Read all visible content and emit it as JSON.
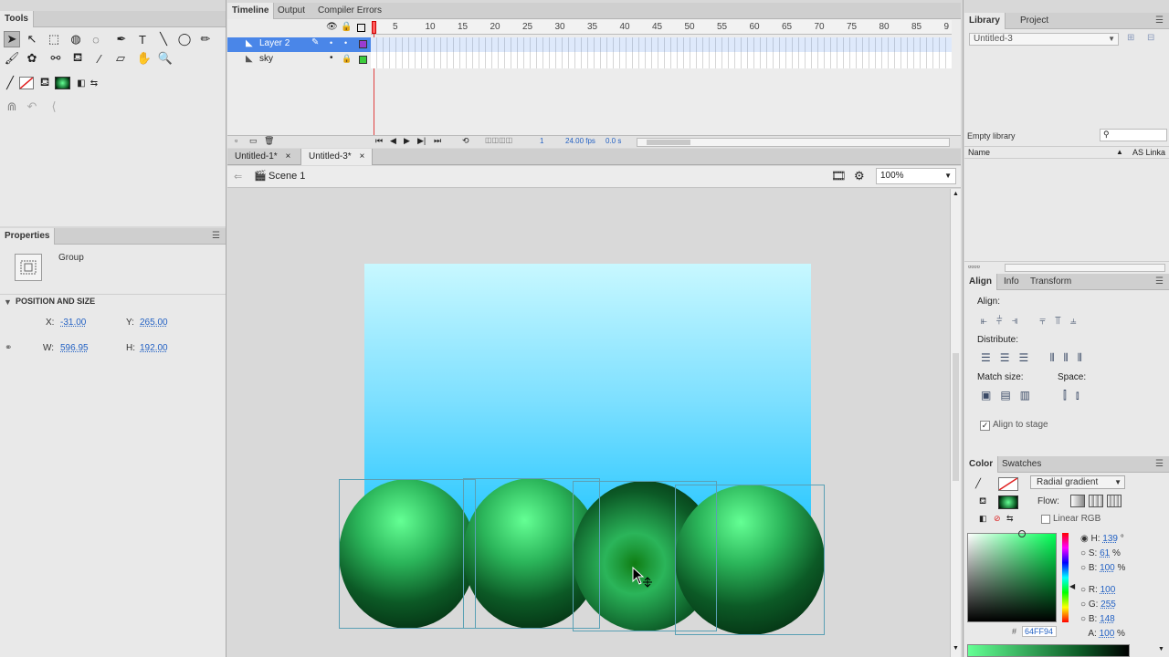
{
  "tools": {
    "tab_label": "Tools"
  },
  "timeline": {
    "tabs": [
      "Timeline",
      "Output",
      "Compiler Errors"
    ],
    "frame_numbers": [
      "5",
      "10",
      "15",
      "20",
      "25",
      "30",
      "35",
      "40",
      "45",
      "50",
      "55",
      "60",
      "65",
      "70",
      "75",
      "80",
      "85",
      "9"
    ],
    "layers": [
      {
        "name": "Layer 2",
        "selected": true,
        "color": "#9b3bd1"
      },
      {
        "name": "sky",
        "selected": false,
        "color": "#3ccc3c"
      }
    ],
    "current_frame": "1",
    "fps": "24.00 fps",
    "time": "0.0 s"
  },
  "documents": {
    "tabs": [
      {
        "label": "Untitled-1*",
        "active": false
      },
      {
        "label": "Untitled-3*",
        "active": true
      }
    ],
    "scene": "Scene 1",
    "zoom": "100%"
  },
  "properties": {
    "tab_label": "Properties",
    "object_type": "Group",
    "section_title": "POSITION AND SIZE",
    "x_label": "X:",
    "x_value": "-31.00",
    "y_label": "Y:",
    "y_value": "265.00",
    "w_label": "W:",
    "w_value": "596.95",
    "h_label": "H:",
    "h_value": "192.00"
  },
  "library": {
    "tabs": [
      "Library",
      "Project"
    ],
    "document": "Untitled-3",
    "empty_text": "Empty library",
    "col_name": "Name",
    "col_link": "AS Linka"
  },
  "align": {
    "tabs": [
      "Align",
      "Info",
      "Transform"
    ],
    "align_label": "Align:",
    "distribute_label": "Distribute:",
    "match_label": "Match size:",
    "space_label": "Space:",
    "stage_label": "Align to stage"
  },
  "color": {
    "tabs": [
      "Color",
      "Swatches"
    ],
    "type": "Radial gradient",
    "flow_label": "Flow:",
    "linear_rgb_label": "Linear RGB",
    "h_label": "H:",
    "h_value": "139",
    "h_unit": "°",
    "s_label": "S:",
    "s_value": "61",
    "s_unit": "%",
    "b_label": "B:",
    "b_value": "100",
    "b_unit": "%",
    "r_label": "R:",
    "r_value": "100",
    "g_label": "G:",
    "g_value": "255",
    "b2_label": "B:",
    "b2_value": "148",
    "a_label": "A:",
    "a_value": "100",
    "a_unit": "%",
    "hex_prefix": "#",
    "hex_value": "64FF94"
  },
  "colors": {
    "sky_top": "#c8f8ff",
    "sky_bottom": "#10c0ff",
    "ball_light": "#64ff94",
    "ball_dark": "#001a08"
  }
}
